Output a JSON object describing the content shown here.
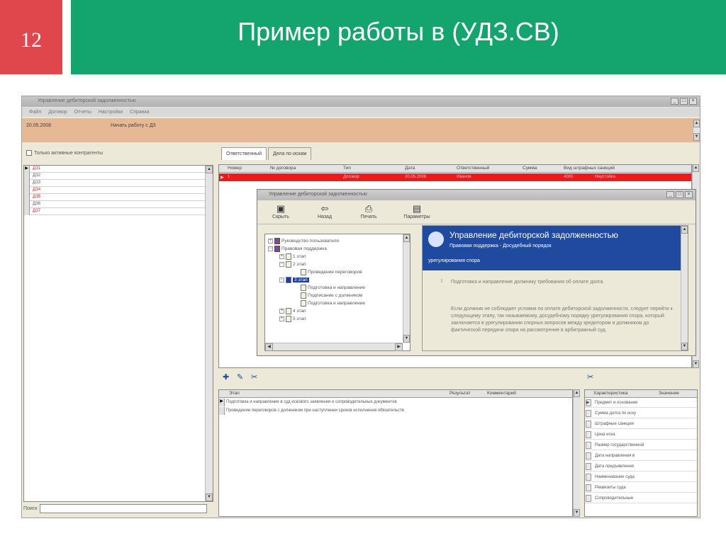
{
  "slide": {
    "number": "12",
    "title": "Пример работы в (УДЗ.СВ)",
    "colors": {
      "number_bg": "#e0474c",
      "banner_bg": "#14a56f",
      "text": "#ffffff"
    }
  },
  "app": {
    "title": "Управление дебиторской задолженностью",
    "window_buttons": [
      "_",
      "□",
      "×"
    ],
    "menu": [
      "Файл",
      "Договор",
      "Отчеты",
      "Настройки",
      "Справка"
    ],
    "info_bar": {
      "date": "20.05.2008",
      "message": "Начать работу с ДЗ",
      "color": "#e6b894"
    },
    "left": {
      "checkbox_label": "Только активные контрагенты",
      "rows": [
        {
          "marker": "▶",
          "text": "ДЗ1",
          "color": "#d02020"
        },
        {
          "marker": "",
          "text": "ДЗ2",
          "color": "#555555"
        },
        {
          "marker": "",
          "text": "ДЗ3",
          "color": "#555555"
        },
        {
          "marker": "",
          "text": "ДЗ4",
          "color": "#d02020"
        },
        {
          "marker": "",
          "text": "ДЗ5",
          "color": "#d02020"
        },
        {
          "marker": "",
          "text": "ДЗ6",
          "color": "#555555"
        },
        {
          "marker": "",
          "text": "ДЗ7",
          "color": "#d02020"
        }
      ],
      "search_label": "Поиск"
    },
    "tabs": [
      "Ответственный",
      "Дела по искам"
    ],
    "grid": {
      "columns": [
        "Номер",
        "№ договора",
        "Тип",
        "Дата",
        "Ответственный",
        "Сумма",
        "Вид штрафных санкций"
      ],
      "selected_row": [
        "1",
        "",
        "Договор",
        "20.05.2008",
        "Иванов",
        "4000",
        "Неустойка"
      ],
      "selected_color": "#ee1a1a"
    },
    "lower": {
      "columns": [
        "Этап",
        "Результат",
        "Комментарий"
      ],
      "rows": [
        "Подготовка и направление в суд искового заявления и сопроводительных документов",
        "Проведение переговоров с должником при наступлении сроков исполнения обязательств"
      ]
    },
    "props": {
      "columns": [
        "Характеристика",
        "Значение"
      ],
      "rows": [
        "Предмет и основание",
        "Сумма долга по иску",
        "Штрафные санкции",
        "Цена иска",
        "Размер государственной",
        "Дата направления в",
        "Дата предъявления",
        "Наименование суда",
        "Реквизиты суда",
        "Сопроводительные"
      ]
    }
  },
  "dialog": {
    "title": "Управление дебиторской задолженностью",
    "toolbar": [
      {
        "icon": "hide-icon",
        "glyph": "▣",
        "label": "Скрыть"
      },
      {
        "icon": "back-icon",
        "glyph": "⇦",
        "label": "Назад"
      },
      {
        "icon": "print-icon",
        "glyph": "⎙",
        "label": "Печать"
      },
      {
        "icon": "options-icon",
        "glyph": "▤",
        "label": "Параметры"
      }
    ],
    "tree": [
      {
        "label": "Руководство пользователя",
        "expander": "+",
        "icon": "book"
      },
      {
        "label": "Правовая поддержка",
        "expander": "−",
        "icon": "book"
      },
      {
        "label": "1 этап",
        "expander": "+",
        "icon": "page"
      },
      {
        "label": "2 этап",
        "expander": "−",
        "icon": "page"
      },
      {
        "label": "Проведение переговоров",
        "expander": "",
        "icon": "page"
      },
      {
        "label": "3 этап",
        "expander": "−",
        "icon": "sel"
      },
      {
        "label": "Подготовка и направление",
        "expander": "",
        "icon": "page"
      },
      {
        "label": "Подписание с должником",
        "expander": "",
        "icon": "page"
      },
      {
        "label": "Подготовка и направление",
        "expander": "",
        "icon": "page"
      },
      {
        "label": "4 этап",
        "expander": "+",
        "icon": "page"
      },
      {
        "label": "5 этап",
        "expander": "+",
        "icon": "page"
      }
    ],
    "help": {
      "h1": "Управление дебиторской задолженностью",
      "h2": "Правовая поддержка - Досудебный порядок",
      "h3": "урегулирования спора",
      "step_no": "I",
      "step_text": "Подготовка и направление должнику требования об оплате долга",
      "body": "Если должник не соблюдает условия по оплате дебиторской задолженности, следует перейти к следующему этапу, так называемому, досудебному порядку урегулирования спора, который заключается в урегулировании спорных вопросов между кредитором и должником до фактической передачи спора на рассмотрение в арбитражный суд.",
      "banner_color": "#1f4aa0"
    }
  }
}
